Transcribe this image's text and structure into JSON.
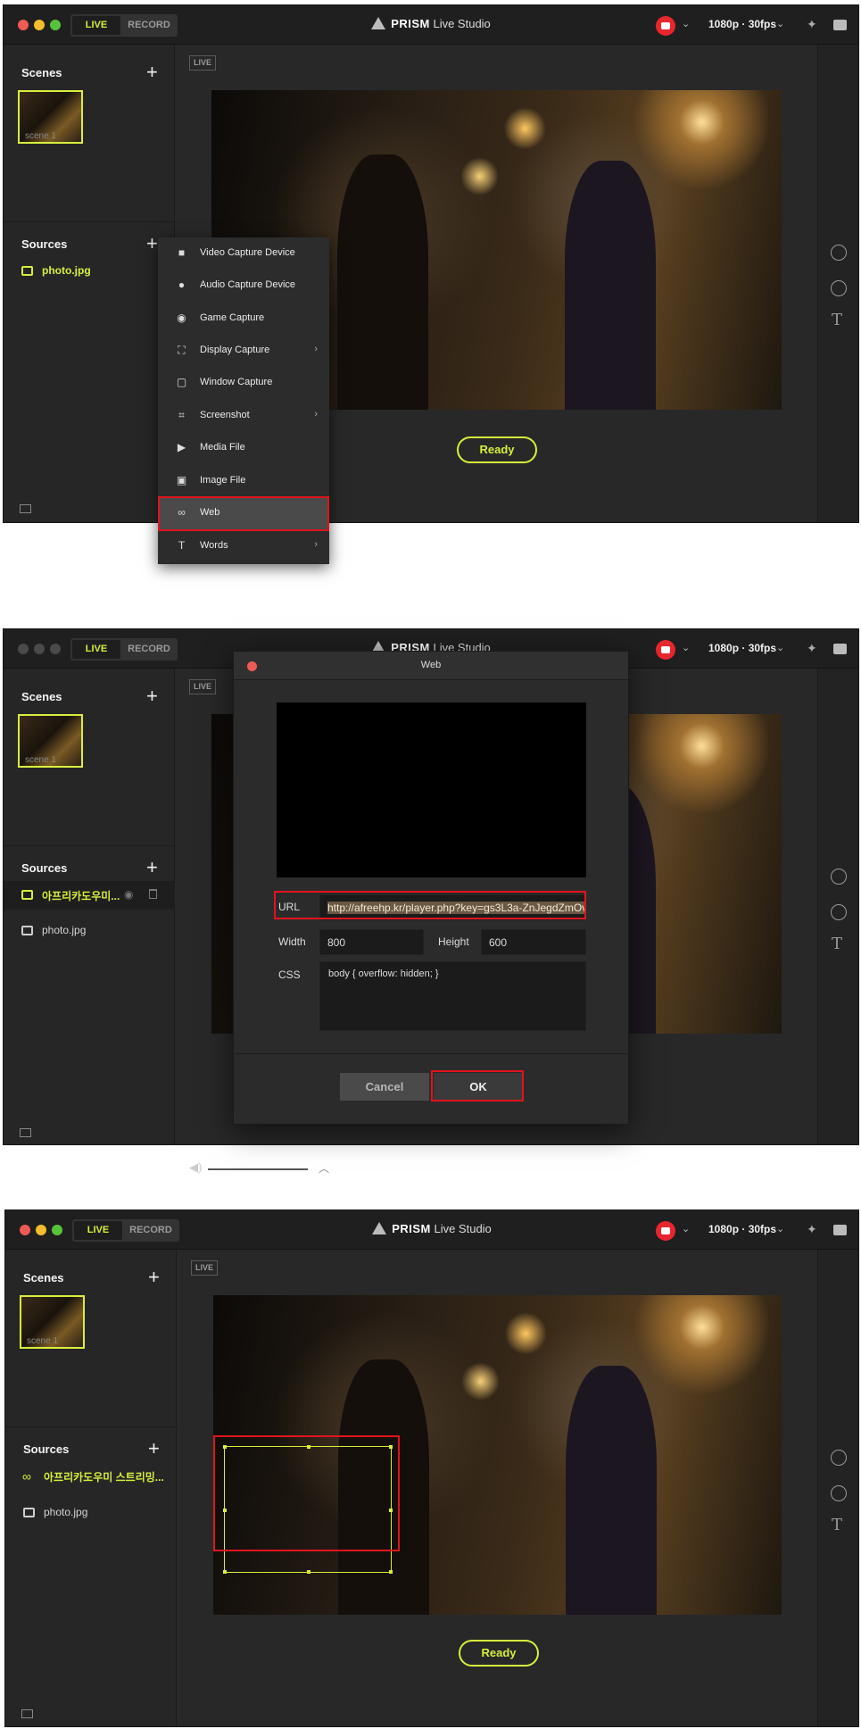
{
  "app": {
    "title_bold": "PRISM",
    "title_rest": " Live Studio",
    "mode_live": "LIVE",
    "mode_record": "RECORD",
    "resolution": "1080p · 30fps",
    "chevron": "⌄",
    "live_badge": "LIVE",
    "ready": "Ready",
    "colors": {
      "accent": "#d8ef3c",
      "highlight_box": "#e0141e",
      "youtube": "#e8262e"
    }
  },
  "sidebar": {
    "scenes_title": "Scenes",
    "sources_title": "Sources",
    "add": "+",
    "scene_label": "scene 1"
  },
  "panel1": {
    "sources": [
      {
        "label": "photo.jpg",
        "icon": "image-icon"
      }
    ],
    "menu": [
      {
        "label": "Video Capture Device",
        "icon": "video-camera-icon"
      },
      {
        "label": "Audio Capture Device",
        "icon": "microphone-icon"
      },
      {
        "label": "Game Capture",
        "icon": "gamepad-icon"
      },
      {
        "label": "Display Capture",
        "icon": "display-capture-icon",
        "arrow": "›"
      },
      {
        "label": "Window Capture",
        "icon": "window-icon"
      },
      {
        "label": "Screenshot",
        "icon": "crop-icon",
        "arrow": "›"
      },
      {
        "label": "Media File",
        "icon": "play-icon"
      },
      {
        "label": "Image File",
        "icon": "image-icon"
      },
      {
        "label": "Web",
        "icon": "link-icon",
        "highlighted": true
      },
      {
        "label": "Words",
        "icon": "text-t-icon",
        "arrow": "›"
      }
    ]
  },
  "panel2": {
    "sources": [
      {
        "label": "아프리카도우미...",
        "icon": "web-source-icon",
        "selected": true
      },
      {
        "label": "photo.jpg",
        "icon": "image-icon"
      }
    ],
    "dialog": {
      "title": "Web",
      "url_label": "URL",
      "url_value": "http://afreehp.kr/player.php?key=gs3L3a-ZnJegdZmOv",
      "width_label": "Width",
      "width_value": "800",
      "height_label": "Height",
      "height_value": "600",
      "css_label": "CSS",
      "css_value": "body { overflow: hidden; }",
      "cancel": "Cancel",
      "ok": "OK"
    }
  },
  "panel3": {
    "sources": [
      {
        "label": "아프리카도우미 스트리밍...",
        "icon": "link-icon",
        "selected": false
      },
      {
        "label": "photo.jpg",
        "icon": "image-icon"
      }
    ]
  }
}
